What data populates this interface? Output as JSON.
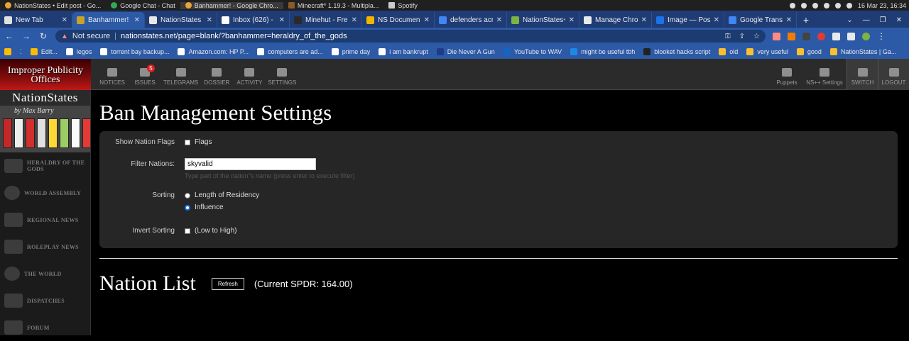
{
  "os_taskbar": {
    "items": [
      "NationStates • Edit post - Go...",
      "Google Chat - Chat",
      "Banhammer! - Google Chro...",
      "Minecraft* 1.19.3 - Multipla...",
      "Spotify"
    ],
    "datetime": "16 Mar 23, 16:34"
  },
  "tabs": [
    {
      "label": "New Tab",
      "color": "#e0e0e0"
    },
    {
      "label": "Banhammer!",
      "color": "#c9a227"
    },
    {
      "label": "NationStates • ",
      "color": "#e8e8e8"
    },
    {
      "label": "Inbox (626) - th",
      "color": "#ffffff"
    },
    {
      "label": "Minehut - Free I",
      "color": "#2a2a2a"
    },
    {
      "label": "NS Documents",
      "color": "#f4b400"
    },
    {
      "label": "defenders acros",
      "color": "#4285f4"
    },
    {
      "label": "NationStates++",
      "color": "#7cb342"
    },
    {
      "label": "Manage Chrom",
      "color": "#e8eaed"
    },
    {
      "label": "Image — Postin",
      "color": "#1a73e8"
    },
    {
      "label": "Google Translat",
      "color": "#4285f4"
    }
  ],
  "address_bar": {
    "security": "Not secure",
    "url": "nationstates.net/page=blank/?banhammer=heraldry_of_the_gods"
  },
  "bookmarks": [
    "Edit...",
    "legos",
    "torrent bay backup...",
    "Amazon.com: HP P...",
    "computers are ad...",
    "prime day",
    "i am bankrupt",
    "Die Never A Gun",
    "YouTube to WAV",
    "might be useful tbh",
    "blooket hacks script",
    "old",
    "very useful",
    "good",
    "NationStates | Ga..."
  ],
  "site_nav": {
    "logo_text": "Improper Publicity Offices",
    "items": [
      {
        "label": "NOTICES"
      },
      {
        "label": "ISSUES",
        "badge": "5"
      },
      {
        "label": "TELEGRAMS"
      },
      {
        "label": "DOSSIER"
      },
      {
        "label": "ACTIVITY"
      },
      {
        "label": "SETTINGS"
      }
    ],
    "right_items": [
      {
        "label": "Puppets"
      },
      {
        "label": "NS++ Settings"
      },
      {
        "label": "SWITCH"
      },
      {
        "label": "LOGOUT"
      }
    ]
  },
  "sidebar": {
    "brand": "NationStates",
    "by": "by Max Barry",
    "items": [
      {
        "label": "HERALDRY OF THE GODS"
      },
      {
        "label": "WORLD ASSEMBLY"
      },
      {
        "label": "REGIONAL NEWS"
      },
      {
        "label": "ROLEPLAY NEWS"
      },
      {
        "label": "THE WORLD"
      },
      {
        "label": "DISPATCHES"
      },
      {
        "label": "FORUM"
      }
    ]
  },
  "main": {
    "title": "Ban Management Settings",
    "settings": {
      "show_flags_label": "Show Nation Flags",
      "flags_option": "Flags",
      "filter_label": "Filter Nations:",
      "filter_value": "skyvalid",
      "filter_hint": "Type part of the nation''s name (press enter to execute filter)",
      "sorting_label": "Sorting",
      "sort_options": [
        "Length of Residency",
        "Influence"
      ],
      "sort_selected": "Influence",
      "invert_label": "Invert Sorting",
      "invert_option": "(Low to High)"
    },
    "nation_list_title": "Nation List",
    "refresh_label": "Refresh",
    "spdr_text": "(Current SPDR: 164.00)"
  }
}
